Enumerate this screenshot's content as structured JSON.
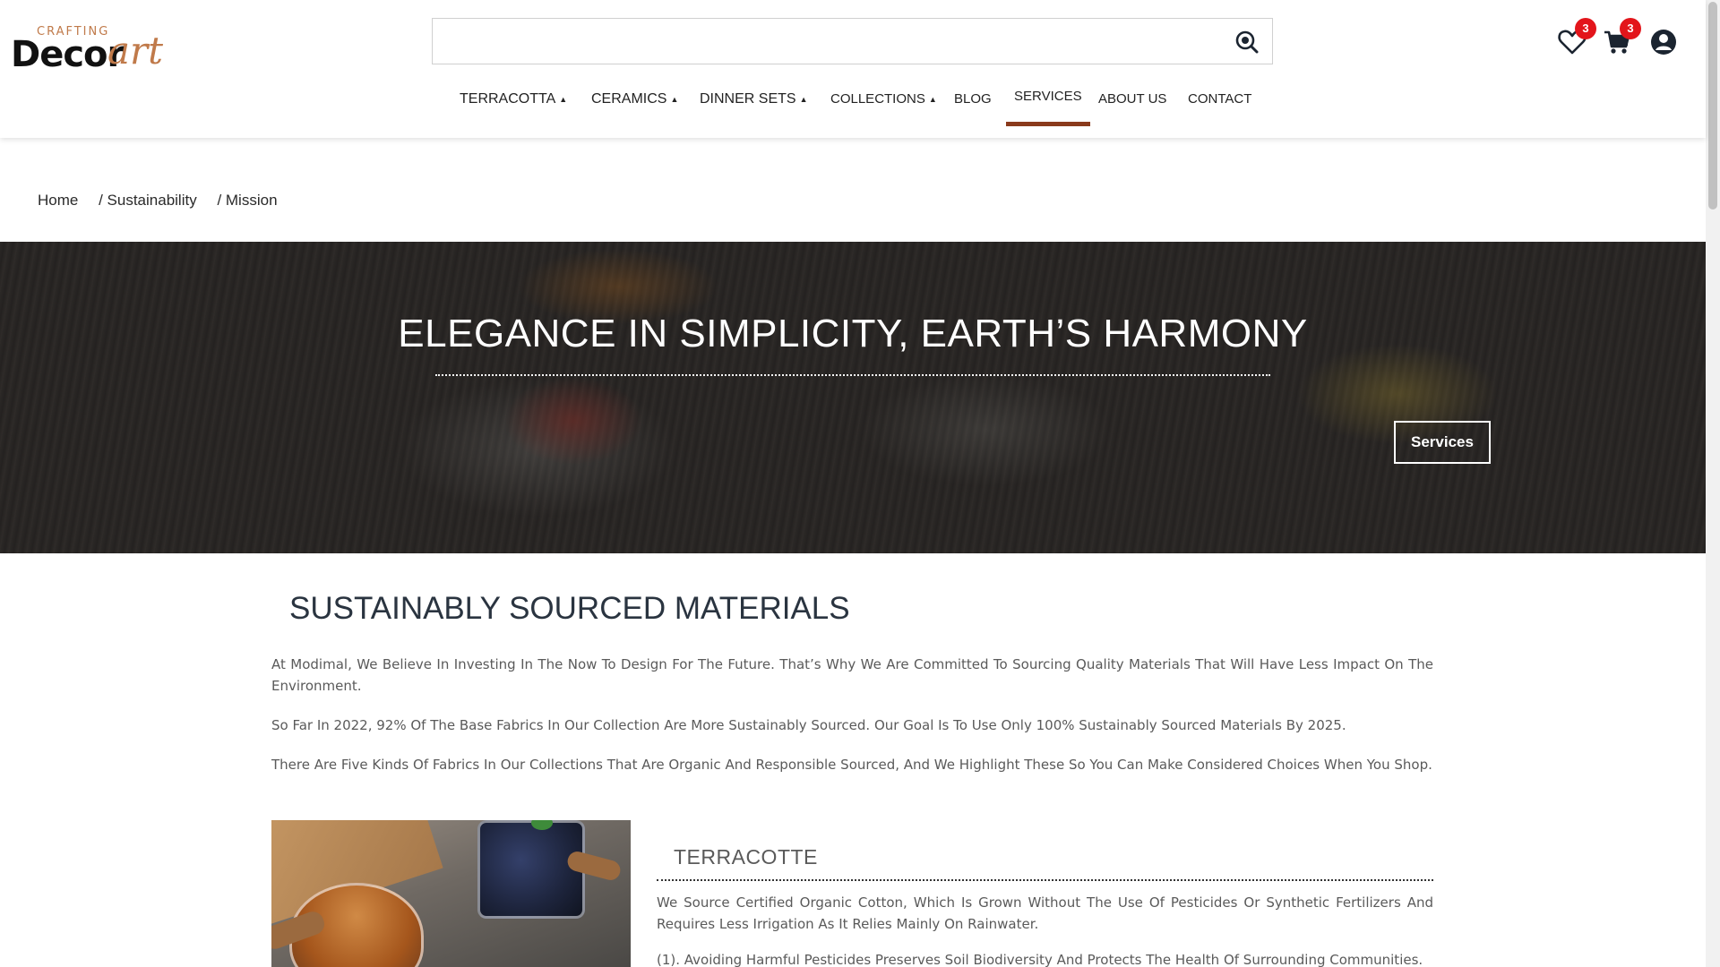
{
  "header": {
    "logo": {
      "top": "CRAFTING",
      "main": "Decor",
      "script": "art"
    },
    "search": {
      "value": "",
      "placeholder": ""
    },
    "wishlist_count": "3",
    "cart_count": "3"
  },
  "nav": {
    "items": [
      {
        "label": "TERRACOTTA",
        "dropdown": true
      },
      {
        "label": "CERAMICS",
        "dropdown": true
      },
      {
        "label": "DINNER SETS",
        "dropdown": true
      },
      {
        "label": "COLLECTIONS",
        "dropdown": true
      },
      {
        "label": "BLOG",
        "dropdown": false
      },
      {
        "label": "SERVICES",
        "dropdown": false,
        "active": true
      },
      {
        "label": "ABOUT US",
        "dropdown": false
      },
      {
        "label": "CONTACT",
        "dropdown": false
      }
    ],
    "caret": "▲"
  },
  "breadcrumb": [
    "Home",
    "/ Sustainability",
    "/ Mission"
  ],
  "hero": {
    "title": "ELEGANCE IN SIMPLICITY, EARTH’S HARMONY",
    "button": "Services"
  },
  "main": {
    "title": "SUSTAINABLY SOURCED MATERIALS",
    "paragraphs": [
      "At Modimal, We Believe In Investing In The Now To Design For The Future. That’s Why We Are Committed To Sourcing Quality Materials That Will Have Less Impact On The Environment.",
      "So Far In 2022, 92% Of The Base Fabrics In Our Collection Are More Sustainably Sourced. Our Goal Is To Use Only 100% Sustainably Sourced Materials By 2025.",
      "There Are Five Kinds Of Fabrics In Our Collections That Are Organic And Responsible Sourced, And We Highlight These So You Can Make Considered Choices When You Shop."
    ],
    "feature": {
      "title": "TERRACOTTE",
      "paragraphs": [
        "We Source Certified Organic Cotton, Which Is Grown Without The Use Of Pesticides Or Synthetic Fertilizers And Requires Less Irrigation As It Relies Mainly On Rainwater.",
        "(1). Avoiding Harmful Pesticides Preserves Soil Biodiversity And Protects The Health Of Surrounding Communities."
      ]
    }
  },
  "colors": {
    "accent": "#8a3a1c",
    "badge": "#e3151b",
    "logo_accent": "#c07a4a"
  }
}
